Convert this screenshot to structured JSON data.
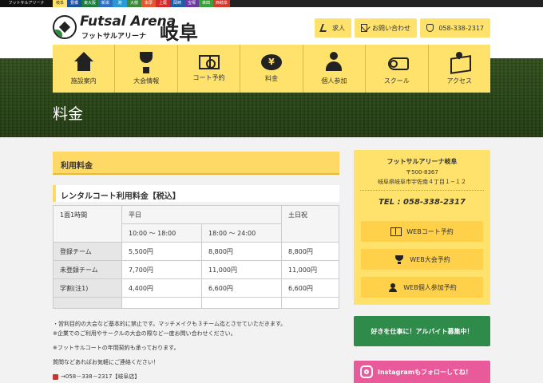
{
  "venue_strip": {
    "brand": "フットサルアリーナ",
    "tabs": [
      {
        "label": "岐阜",
        "color": "#ffe26b",
        "text": "#222"
      },
      {
        "label": "豊橋",
        "color": "#1c4ea0",
        "text": "#fff"
      },
      {
        "label": "東大阪",
        "color": "#1a7d3a",
        "text": "#fff"
      },
      {
        "label": "新栄",
        "color": "#2d6ec0",
        "text": "#fff"
      },
      {
        "label": "港",
        "color": "#2a9bd2",
        "text": "#fff"
      },
      {
        "label": "大樹",
        "color": "#3a8a3a",
        "text": "#fff"
      },
      {
        "label": "本厚",
        "color": "#e4572e",
        "text": "#fff"
      },
      {
        "label": "上尾",
        "color": "#d42a2a",
        "text": "#fff"
      },
      {
        "label": "岡崎",
        "color": "#1d5ea8",
        "text": "#fff"
      },
      {
        "label": "宝塚",
        "color": "#6a3aa0",
        "text": "#fff"
      },
      {
        "label": "幸田",
        "color": "#3aa03a",
        "text": "#fff"
      },
      {
        "label": "西岐阜",
        "color": "#d9382c",
        "text": "#fff"
      }
    ]
  },
  "header": {
    "logo_en": "Futsal Arena",
    "logo_jp": "フットサルアリーナ",
    "logo_city": "岐阜",
    "buttons": [
      {
        "label": "求人",
        "icon": "handshake-icon"
      },
      {
        "label": "お問い合わせ",
        "icon": "mail-icon"
      },
      {
        "label": "058-338-2317",
        "icon": "phone-icon"
      }
    ]
  },
  "nav": [
    {
      "label": "施設案内",
      "icon": "house-icon"
    },
    {
      "label": "大会情報",
      "icon": "trophy-icon"
    },
    {
      "label": "コート予約",
      "icon": "court-icon"
    },
    {
      "label": "料金",
      "icon": "yen-icon"
    },
    {
      "label": "個人参加",
      "icon": "person-icon"
    },
    {
      "label": "スクール",
      "icon": "whistle-icon"
    },
    {
      "label": "アクセス",
      "icon": "map-icon"
    }
  ],
  "page_title": "料金",
  "main": {
    "section_title": "利用料金",
    "subsection_title": "レンタルコート利用料金【税込】",
    "table": {
      "h_unit": "1面1時間",
      "h_weekday": "平日",
      "h_holiday": "土日祝",
      "h_time1": "10:00 ～ 18:00",
      "h_time2": "18:00 ～ 24:00",
      "rows": [
        {
          "label": "登録チーム",
          "v1": "5,500円",
          "v2": "8,800円",
          "v3": "8,800円"
        },
        {
          "label": "未登録チーム",
          "v1": "7,700円",
          "v2": "11,000円",
          "v3": "11,000円"
        },
        {
          "label": "学割(注1)",
          "v1": "4,400円",
          "v2": "6,600円",
          "v3": "6,600円"
        }
      ]
    },
    "notes": [
      "・営利目的の大会など基本的に禁止です。マッチメイクも３チーム迄とさせていただきます。",
      "※企業でのご利用やサークルの大会の際など一度お問い合わせください。",
      "※フットサルコートの年間契約も承っております。",
      "質問などあればお気軽にご連絡ください！",
      "→058－338－2317【岐阜店】"
    ]
  },
  "sidebar": {
    "name": "フットサルアリーナ岐阜",
    "zip": "〒500-8367",
    "address": "岐阜県岐阜市宇佐南４丁目１−１２",
    "tel": "TEL : 058-338-2317",
    "buttons": [
      {
        "label": "WEBコート予約",
        "icon": "court-icon"
      },
      {
        "label": "WEB大会予約",
        "icon": "trophy-icon"
      },
      {
        "label": "WEB個人参加予約",
        "icon": "person-icon"
      }
    ],
    "job_banner": "好きを仕事に！アルバイト募集中！",
    "insta_banner": "Instagramもフォローしてね！"
  }
}
